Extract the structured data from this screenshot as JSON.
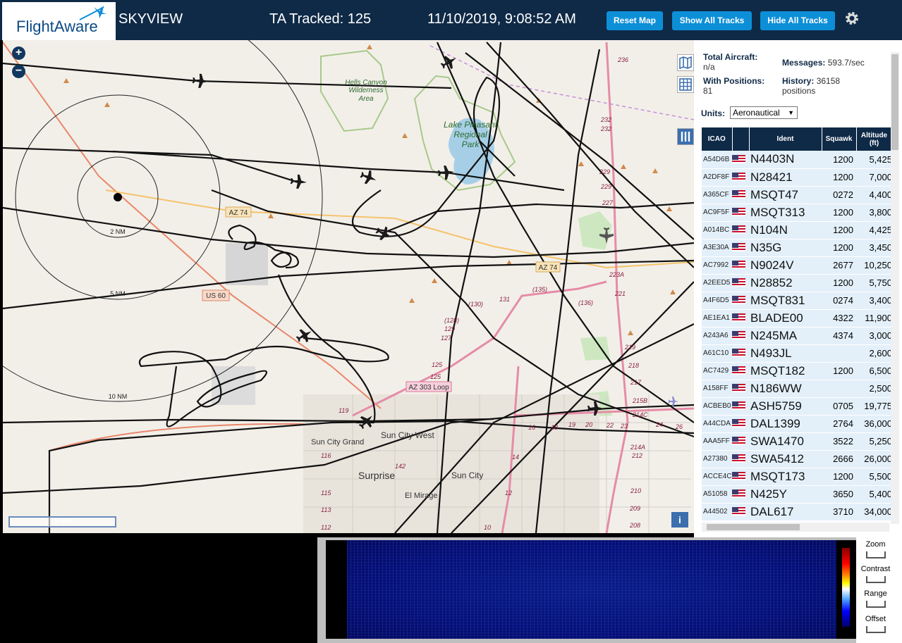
{
  "header": {
    "logo_text": "FlightAware",
    "site_name": "SKYVIEW",
    "tracked_label": "TA Tracked: 125",
    "datetime": "11/10/2019, 9:08:52 AM",
    "buttons": {
      "reset": "Reset Map",
      "show_all": "Show All Tracks",
      "hide_all": "Hide All Tracks"
    }
  },
  "map": {
    "zoom_in": "+",
    "zoom_out": "−",
    "scale_label": "5 nm",
    "info_label": "i",
    "labels": {
      "hells_canyon": [
        "Hells Canyon",
        "Wilderness",
        "Area"
      ],
      "lake_pleasant": [
        "Lake Pleasant",
        "Regional",
        "Park"
      ],
      "az74_a": "AZ 74",
      "az74_b": "AZ 74",
      "us60": "US 60",
      "az303": "AZ 303 Loop",
      "ring_2nm": "2 NM",
      "ring_5nm": "5 NM",
      "ring_10nm": "10 NM",
      "sun_city_grand": "Sun City Grand",
      "sun_city_west": "Sun City West",
      "surprise": "Surprise",
      "sun_city": "Sun City",
      "el_mirage": "El Mirage",
      "rt236": "236",
      "rt232a": "232",
      "rt232b": "232",
      "rt229a": "229",
      "rt229b": "229",
      "rt227": "227",
      "rt223a": "223A",
      "rt221": "221",
      "rt219": "219",
      "rt218": "218",
      "rt217": "217",
      "rt215b": "215B",
      "rt214c": "214C",
      "rt214a": "214A",
      "rt212": "212",
      "rt210": "210",
      "rt209": "209",
      "rt208": "208",
      "rt135": "(135)",
      "rt136": "(136)",
      "rt130": "(130)",
      "rt131": "131",
      "rt128": "(128)",
      "rt129": "129",
      "rt127": "127",
      "rt125a": "125",
      "rt125b": "125",
      "rt119": "119",
      "rt116": "116",
      "rt115": "115",
      "rt113": "113",
      "rt112": "112",
      "rt142": "142",
      "rt10": "10",
      "rt12": "12",
      "rt14": "14",
      "rt16": "16",
      "rt18": "18",
      "rt19": "19",
      "rt20": "20",
      "rt22": "22",
      "rt23": "23",
      "rt24": "24",
      "rt26": "26"
    }
  },
  "stats": {
    "total_aircraft_label": "Total Aircraft:",
    "total_aircraft_value": "n/a",
    "with_positions_label": "With Positions:",
    "with_positions_value": "81",
    "messages_label": "Messages:",
    "messages_value": "593.7/sec",
    "history_label": "History:",
    "history_value": "36158",
    "history_unit": "positions"
  },
  "units": {
    "label": "Units:",
    "selected": "Aeronautical"
  },
  "table": {
    "columns": [
      "ICAO",
      "",
      "Ident",
      "Squawk",
      "Altitude (ft)"
    ],
    "rows": [
      {
        "icao": "A54D6B",
        "ident": "N4403N",
        "squawk": "1200",
        "alt": "5,425"
      },
      {
        "icao": "A2DF8F",
        "ident": "N28421",
        "squawk": "1200",
        "alt": "7,000"
      },
      {
        "icao": "A365CF",
        "ident": "MSQT47",
        "squawk": "0272",
        "alt": "4,400"
      },
      {
        "icao": "AC9F5F",
        "ident": "MSQT313",
        "squawk": "1200",
        "alt": "3,800"
      },
      {
        "icao": "A014BC",
        "ident": "N104N",
        "squawk": "1200",
        "alt": "4,425"
      },
      {
        "icao": "A3E30A",
        "ident": "N35G",
        "squawk": "1200",
        "alt": "3,450"
      },
      {
        "icao": "AC7992",
        "ident": "N9024V",
        "squawk": "2677",
        "alt": "10,250"
      },
      {
        "icao": "A2EED5",
        "ident": "N28852",
        "squawk": "1200",
        "alt": "5,750"
      },
      {
        "icao": "A4F6D5",
        "ident": "MSQT831",
        "squawk": "0274",
        "alt": "3,400"
      },
      {
        "icao": "AE1EA1",
        "ident": "BLADE00",
        "squawk": "4322",
        "alt": "11,900"
      },
      {
        "icao": "A243A6",
        "ident": "N245MA",
        "squawk": "4374",
        "alt": "3,000"
      },
      {
        "icao": "A61C10",
        "ident": "N493JL",
        "squawk": "",
        "alt": "2,600"
      },
      {
        "icao": "AC7429",
        "ident": "MSQT182",
        "squawk": "1200",
        "alt": "6,500"
      },
      {
        "icao": "A158FF",
        "ident": "N186WW",
        "squawk": "",
        "alt": "2,500"
      },
      {
        "icao": "ACBEB0",
        "ident": "ASH5759",
        "squawk": "0705",
        "alt": "19,775"
      },
      {
        "icao": "A44CDA",
        "ident": "DAL1399",
        "squawk": "2764",
        "alt": "36,000"
      },
      {
        "icao": "AAA5FF",
        "ident": "SWA1470",
        "squawk": "3522",
        "alt": "5,250"
      },
      {
        "icao": "A27380",
        "ident": "SWA5412",
        "squawk": "2666",
        "alt": "26,000"
      },
      {
        "icao": "ACCE4C",
        "ident": "MSQT173",
        "squawk": "1200",
        "alt": "5,500"
      },
      {
        "icao": "A51058",
        "ident": "N425Y",
        "squawk": "3650",
        "alt": "5,400"
      },
      {
        "icao": "A44502",
        "ident": "DAL617",
        "squawk": "3710",
        "alt": "34,000"
      }
    ]
  },
  "spectrum_controls": {
    "zoom": "Zoom",
    "contrast": "Contrast",
    "range": "Range",
    "offset": "Offset"
  },
  "colors": {
    "header_bg": "#0f2a47",
    "button": "#0d8fd8",
    "map_bg": "#f2efe9",
    "row_bg": "#e3f0fa",
    "track": "#111111"
  },
  "icons": {
    "plane": "plane-icon",
    "gear": "gear-icon",
    "map_type": "map-layers-icon",
    "grid": "grid-icon",
    "columns": "columns-icon"
  }
}
